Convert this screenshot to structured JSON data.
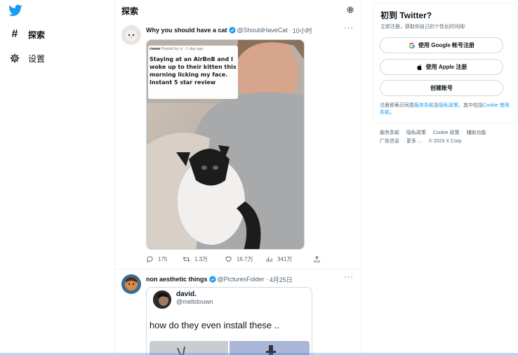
{
  "nav": {
    "items": [
      {
        "label": "探索",
        "icon": "hashtag-icon",
        "active": true
      },
      {
        "label": "设置",
        "icon": "gear-icon",
        "active": false
      }
    ]
  },
  "main": {
    "title": "探索",
    "tweets": [
      {
        "name": "Why you should have a cat",
        "handle": "@ShouldHaveCat",
        "time": "10小时",
        "more": "···",
        "media_text": "Staying at an AirBnB and I woke up to their kitten this morning licking my face. Instant 5 star review",
        "media_meta": "Posted by u/ · 1 day ago",
        "media_user": "r/aww",
        "stats": {
          "replies": "175",
          "retweets": "1.3万",
          "likes": "16.7万",
          "views": "341万"
        }
      },
      {
        "name": "non aesthetic things",
        "handle": "@PicturesFolder",
        "time": "4月25日",
        "more": "···",
        "quote": {
          "name": "david.",
          "handle": "@meltdouwn",
          "text": "how do they even install these .."
        }
      }
    ]
  },
  "sidebar": {
    "title": "初到 Twitter?",
    "subtitle": "立即注册，获取你自己的个性化时间线!",
    "google_label": "使用 Google 帐号注册",
    "apple_label": "使用 Apple 注册",
    "create_label": "创建账号",
    "terms_prefix": "注册即表示同意",
    "terms_link1": "服务条款",
    "terms_mid": "及",
    "terms_link2": "隐私政策",
    "terms_mid2": "，其中包括",
    "terms_link3": "Cookie 使用条款",
    "terms_end": "。",
    "footer": {
      "tos": "服务条款",
      "privacy": "隐私政策",
      "cookie": "Cookie 政策",
      "accessibility": "辅助功能",
      "ads": "广告信息",
      "more": "更多 ...",
      "copyright": "© 2023 X Corp."
    }
  },
  "colors": {
    "accent": "#1d9bf0",
    "text": "#0f1419",
    "muted": "#536471",
    "border": "#eff3f4"
  }
}
